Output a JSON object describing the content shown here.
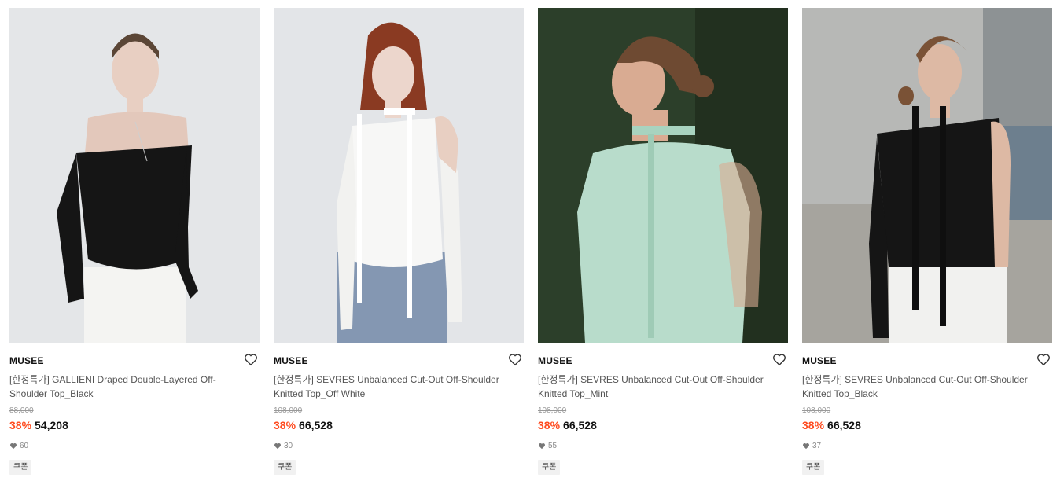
{
  "products": [
    {
      "brand": "MUSEE",
      "title": "[한정특가] GALLIENI Draped Double-Layered Off-Shoulder Top_Black",
      "original_price": "88,000",
      "discount": "38%",
      "price": "54,208",
      "likes": "60",
      "coupon": "쿠폰"
    },
    {
      "brand": "MUSEE",
      "title": "[한정특가] SEVRES Unbalanced Cut-Out Off-Shoulder Knitted Top_Off White",
      "original_price": "108,000",
      "discount": "38%",
      "price": "66,528",
      "likes": "30",
      "coupon": "쿠폰"
    },
    {
      "brand": "MUSEE",
      "title": "[한정특가] SEVRES Unbalanced Cut-Out Off-Shoulder Knitted Top_Mint",
      "original_price": "108,000",
      "discount": "38%",
      "price": "66,528",
      "likes": "55",
      "coupon": "쿠폰"
    },
    {
      "brand": "MUSEE",
      "title": "[한정특가] SEVRES Unbalanced Cut-Out Off-Shoulder Knitted Top_Black",
      "original_price": "108,000",
      "discount": "38%",
      "price": "66,528",
      "likes": "37",
      "coupon": "쿠폰"
    }
  ],
  "icons": {
    "wishlist": "heart-outline-icon",
    "likes": "heart-filled-icon"
  },
  "colors": {
    "discount": "#ff4b1f",
    "brand_text": "#111111",
    "title_text": "#555555",
    "muted_text": "#999999",
    "coupon_bg": "#f1f1f1"
  }
}
